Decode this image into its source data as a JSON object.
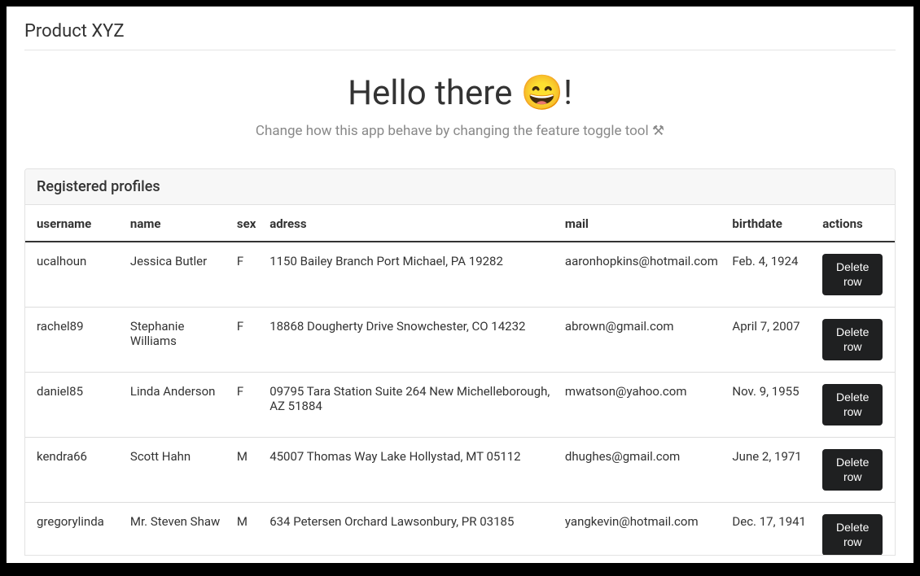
{
  "brand": "Product XYZ",
  "hero": {
    "title": "Hello there 😄!",
    "subtitle": "Change how this app behave by changing the feature toggle tool ⚒"
  },
  "panel": {
    "title": "Registered profiles"
  },
  "table": {
    "headers": {
      "username": "username",
      "name": "name",
      "sex": "sex",
      "address": "adress",
      "mail": "mail",
      "birthdate": "birthdate",
      "actions": "actions"
    },
    "rows": [
      {
        "username": "ucalhoun",
        "name": "Jessica Butler",
        "sex": "F",
        "address": "1150 Bailey Branch Port Michael, PA 19282",
        "mail": "aaronhopkins@hotmail.com",
        "birthdate": "Feb. 4, 1924",
        "action": "Delete row"
      },
      {
        "username": "rachel89",
        "name": "Stephanie Williams",
        "sex": "F",
        "address": "18868 Dougherty Drive Snowchester, CO 14232",
        "mail": "abrown@gmail.com",
        "birthdate": "April 7, 2007",
        "action": "Delete row"
      },
      {
        "username": "daniel85",
        "name": "Linda Anderson",
        "sex": "F",
        "address": "09795 Tara Station Suite 264 New Michelleborough, AZ 51884",
        "mail": "mwatson@yahoo.com",
        "birthdate": "Nov. 9, 1955",
        "action": "Delete row"
      },
      {
        "username": "kendra66",
        "name": "Scott Hahn",
        "sex": "M",
        "address": "45007 Thomas Way Lake Hollystad, MT 05112",
        "mail": "dhughes@gmail.com",
        "birthdate": "June 2, 1971",
        "action": "Delete row"
      },
      {
        "username": "gregorylinda",
        "name": "Mr. Steven Shaw",
        "sex": "M",
        "address": "634 Petersen Orchard Lawsonbury, PR 03185",
        "mail": "yangkevin@hotmail.com",
        "birthdate": "Dec. 17, 1941",
        "action": "Delete row"
      }
    ]
  }
}
